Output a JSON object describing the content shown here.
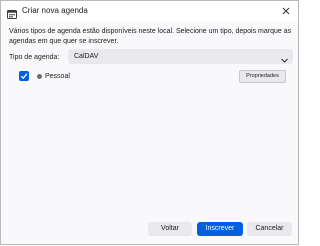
{
  "window": {
    "title": "Criar nova agenda"
  },
  "description": "Vários tipos de agenda estão disponíveis neste local. Selecione um tipo, depois marque as agendas em que quer se inscrever.",
  "type_selector": {
    "label": "Tipo de agenda:",
    "selected": "CalDAV"
  },
  "calendars": [
    {
      "checked": true,
      "color": "#6d6d6d",
      "name": "Pessoal",
      "properties_label": "Propriedades"
    }
  ],
  "footer": {
    "back_label": "Voltar",
    "subscribe_label": "Inscrever",
    "cancel_label": "Cancelar"
  },
  "colors": {
    "accent": "#0060df",
    "button_bg": "#e9e9ed"
  },
  "icons": {
    "app": "calendar-icon",
    "close": "close-icon",
    "dropdown": "chevron-down-icon",
    "check": "check-icon"
  }
}
